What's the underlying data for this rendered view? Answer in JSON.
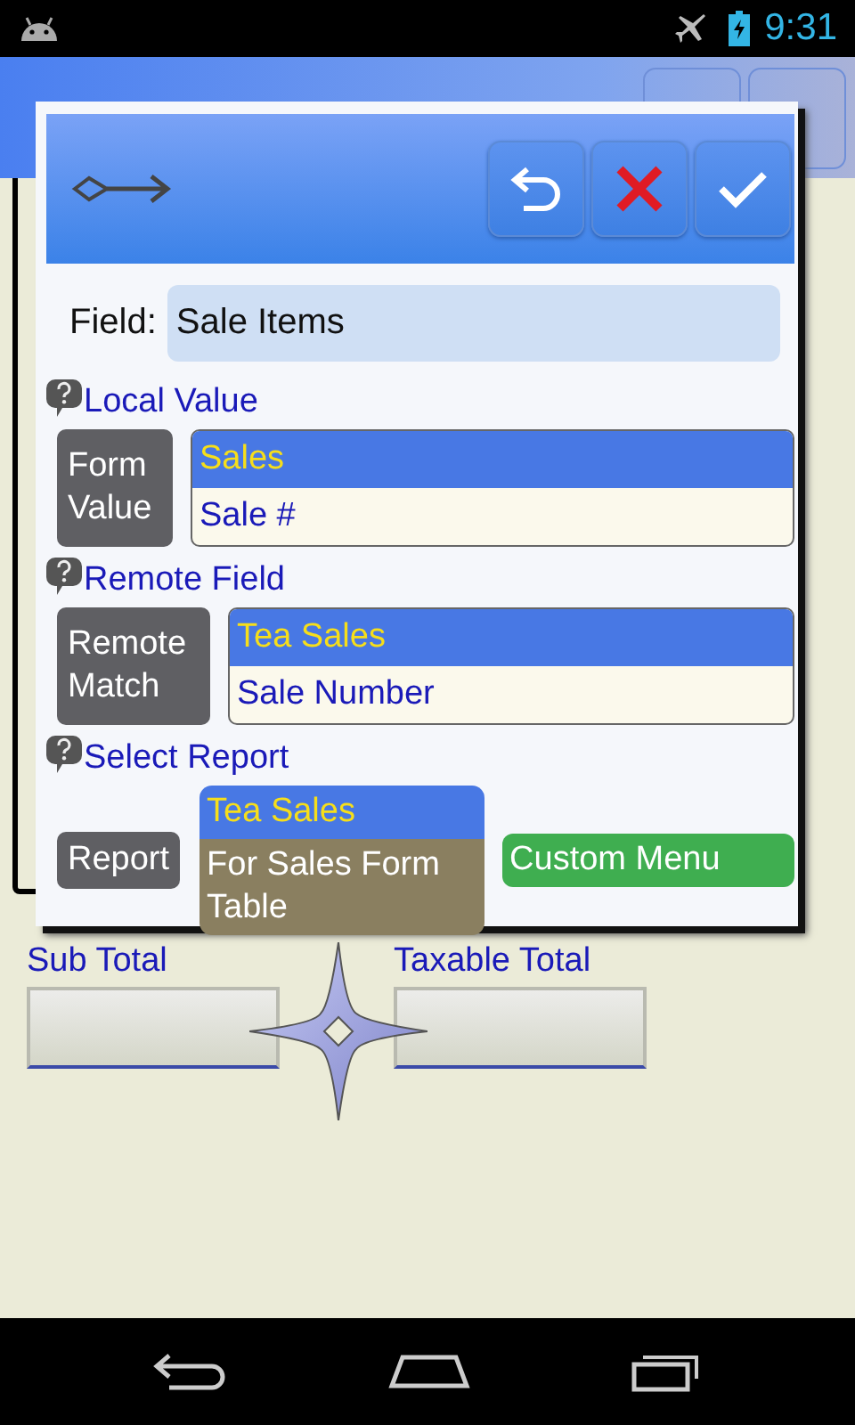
{
  "status_bar": {
    "time": "9:31"
  },
  "dialog": {
    "field_label": "Field:",
    "field_value": "Sale Items",
    "sections": [
      {
        "title": "Local Value",
        "kind": "list",
        "button": "Form Value",
        "options": [
          {
            "label": "Sales",
            "selected": true
          },
          {
            "label": "Sale #",
            "selected": false
          }
        ]
      },
      {
        "title": "Remote Field",
        "kind": "list",
        "button": "Remote Match",
        "options": [
          {
            "label": "Tea Sales",
            "selected": true
          },
          {
            "label": "Sale Number",
            "selected": false
          }
        ]
      },
      {
        "title": "Select Report",
        "kind": "menu",
        "button": "Report",
        "options": [
          {
            "label": "Tea Sales",
            "selected": true
          },
          {
            "label": "For Sales Form Table",
            "selected": false
          }
        ],
        "extra_button": "Custom Menu"
      }
    ]
  },
  "form": {
    "fields": [
      {
        "label": "Sub Total"
      },
      {
        "label": "Taxable Total"
      }
    ]
  }
}
